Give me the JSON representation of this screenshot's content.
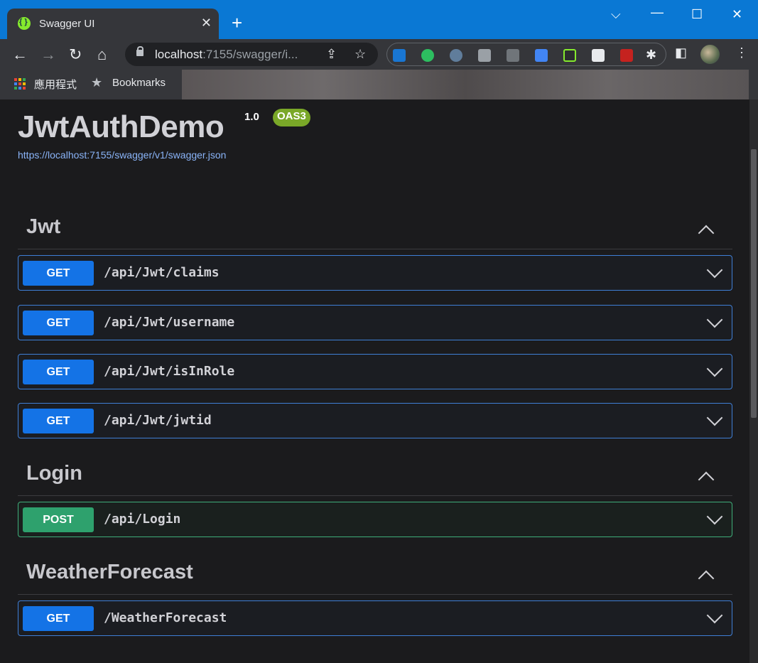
{
  "browser": {
    "tab_title": "Swagger UI",
    "tab_close": "✕",
    "new_tab": "+",
    "url_host": "localhost",
    "url_rest": ":7155/swagger/i...",
    "bookmarks": [
      {
        "label": "應用程式"
      },
      {
        "label": "Bookmarks"
      }
    ]
  },
  "api": {
    "title": "JwtAuthDemo",
    "version": "1.0",
    "badge": "OAS3",
    "spec_url": "https://localhost:7155/swagger/v1/swagger.json"
  },
  "tags": [
    {
      "name": "Jwt",
      "operations": [
        {
          "method": "GET",
          "path": "/api/Jwt/claims"
        },
        {
          "method": "GET",
          "path": "/api/Jwt/username"
        },
        {
          "method": "GET",
          "path": "/api/Jwt/isInRole"
        },
        {
          "method": "GET",
          "path": "/api/Jwt/jwtid"
        }
      ]
    },
    {
      "name": "Login",
      "operations": [
        {
          "method": "POST",
          "path": "/api/Login"
        }
      ]
    },
    {
      "name": "WeatherForecast",
      "operations": [
        {
          "method": "GET",
          "path": "/WeatherForecast"
        }
      ]
    }
  ],
  "colors": {
    "get": "#1473e6",
    "post": "#2ea16d",
    "oas_badge": "#7aa828",
    "titlebar": "#0a78d4"
  }
}
